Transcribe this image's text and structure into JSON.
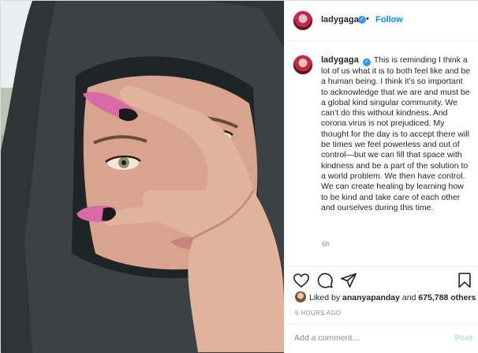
{
  "post": {
    "author": {
      "username": "ladygaga",
      "verified_icon": "verified-badge-icon",
      "follow_label": "Follow",
      "separator": "•"
    },
    "photo": {
      "semantic": "post-photo"
    },
    "caption": {
      "username": "ladygaga",
      "text": "This is reminding I think a lot of us what it is to both feel like and be a human being. I think it’s so important to acknowledge that we are and must be a global kind singular community. We can’t do this without kindness. And corona virus is not prejudiced. My thought for the day is to accept there will be times we feel powerless and out of control—but we can fill that space with kindness and be a part of the solution to a world problem. We then have control. We can create healing by learning how to be kind and take care of each other and ourselves during this time.",
      "time_ago": "6h"
    },
    "actions": {
      "like_icon": "heart-icon",
      "comment_icon": "comment-icon",
      "share_icon": "share-icon",
      "save_icon": "bookmark-icon"
    },
    "likes": {
      "prefix": "Liked by",
      "liker": "ananyapanday",
      "joiner": "and",
      "others": "675,788 others"
    },
    "posted_at": "6 HOURS AGO",
    "comment_box": {
      "placeholder": "Add a comment…",
      "post_label": "Post"
    },
    "colors": {
      "accent": "#0095f6",
      "verified": "#3897f0",
      "muted": "#8e8e8e",
      "border": "#dbdbdb"
    }
  }
}
